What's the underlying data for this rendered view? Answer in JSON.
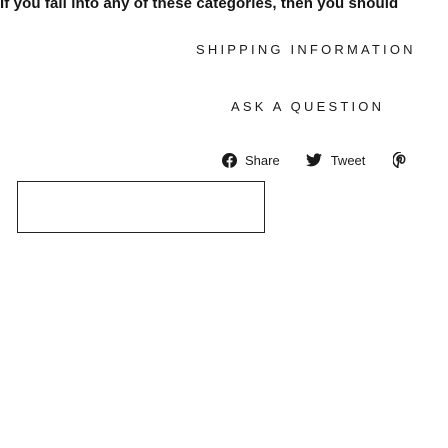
{
  "intro": {
    "text": "If you fall into any of these categories, then you should"
  },
  "tabs": {
    "shipping": "SHIPPING INFORMATION",
    "ask": "ASK A QUESTION"
  },
  "share": {
    "facebook": {
      "label": "Share",
      "icon": "facebook-icon"
    },
    "twitter": {
      "label": "Tweet",
      "icon": "twitter-icon"
    },
    "pinterest": {
      "label": "",
      "icon": "pinterest-icon"
    }
  },
  "colors": {
    "text": "#111111",
    "border": "#222222"
  }
}
